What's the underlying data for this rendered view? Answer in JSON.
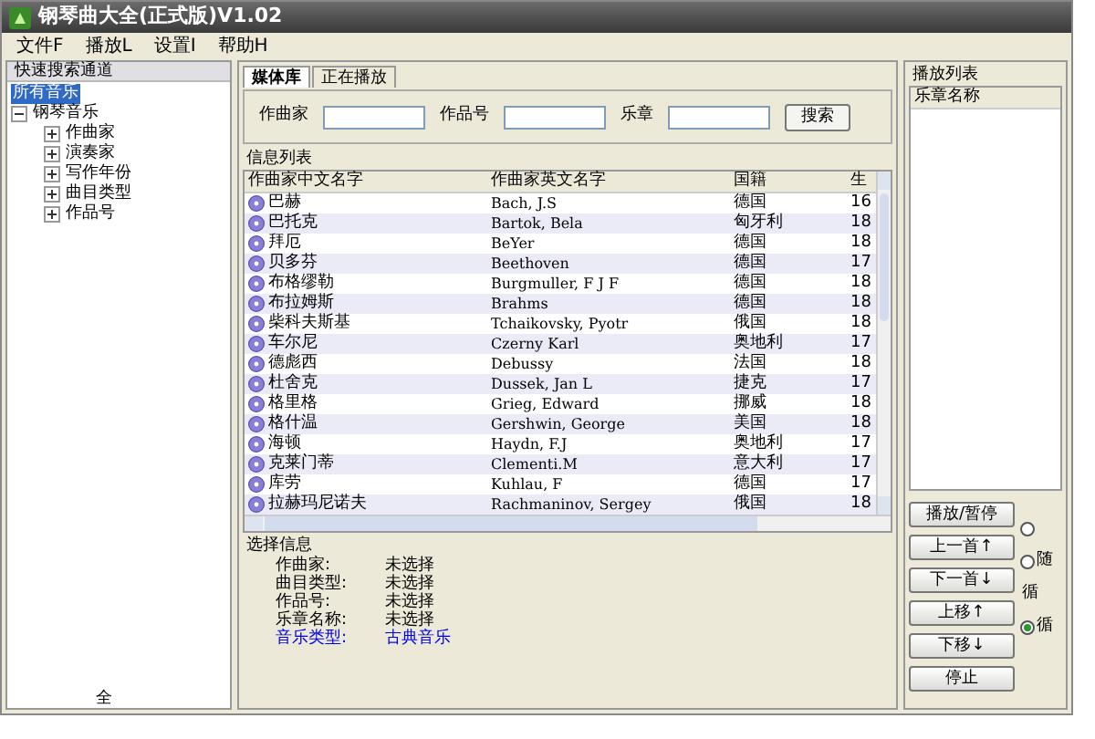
{
  "window": {
    "title": "钢琴曲大全(正式版)V1.02"
  },
  "menu": [
    "文件F",
    "播放L",
    "设置I",
    "帮助H"
  ],
  "sidebar": {
    "title": "快速搜索通道",
    "items": [
      {
        "label": "所有音乐",
        "selected": true
      },
      {
        "label": "钢琴音乐",
        "selected": false,
        "expanded": true,
        "children": [
          {
            "label": "作曲家",
            "selected": false,
            "expanded": false
          },
          {
            "label": "演奏家",
            "selected": false,
            "expanded": false
          },
          {
            "label": "写作年份",
            "selected": false,
            "expanded": false
          },
          {
            "label": "曲目类型",
            "selected": false,
            "expanded": false
          },
          {
            "label": "作品号",
            "selected": false,
            "expanded": false
          }
        ]
      }
    ],
    "footer": "全"
  },
  "tabs": [
    {
      "label": "媒体库",
      "selected": true
    },
    {
      "label": "正在播放",
      "selected": false
    }
  ],
  "search": {
    "fields": [
      {
        "label": "作曲家"
      },
      {
        "label": "作品号"
      },
      {
        "label": "乐章"
      }
    ],
    "button": "搜索"
  },
  "table": {
    "title": "信息列表",
    "columns": [
      "作曲家中文名字",
      "作曲家英文名字",
      "国籍",
      "生"
    ],
    "rows": [
      [
        "巴赫",
        "Bach, J.S",
        "德国",
        "16"
      ],
      [
        "巴托克",
        "Bartok, Bela",
        "匈牙利",
        "18"
      ],
      [
        "拜厄",
        "BeYer",
        "德国",
        "18"
      ],
      [
        "贝多芬",
        "Beethoven",
        "德国",
        "17"
      ],
      [
        "布格缪勒",
        "Burgmuller, F J F",
        "德国",
        "18"
      ],
      [
        "布拉姆斯",
        "Brahms",
        "德国",
        "18"
      ],
      [
        "柴科夫斯基",
        "Tchaikovsky, Pyotr",
        "俄国",
        "18"
      ],
      [
        "车尔尼",
        "Czerny Karl",
        "奥地利",
        "17"
      ],
      [
        "德彪西",
        "Debussy",
        "法国",
        "18"
      ],
      [
        "杜舍克",
        "Dussek, Jan L",
        "捷克",
        "17"
      ],
      [
        "格里格",
        "Grieg, Edward",
        "挪威",
        "18"
      ],
      [
        "格什温",
        "Gershwin, George",
        "美国",
        "18"
      ],
      [
        "海顿",
        "Haydn, F.J",
        "奥地利",
        "17"
      ],
      [
        "克莱门蒂",
        "Clementi.M",
        "意大利",
        "17"
      ],
      [
        "库劳",
        "Kuhlau, F",
        "德国",
        "17"
      ],
      [
        "拉赫玛尼诺夫",
        "Rachmaninov, Sergey",
        "俄国",
        "18"
      ]
    ]
  },
  "selection_info": {
    "title": "选择信息",
    "items": [
      {
        "label": "作曲家:",
        "value": "未选择",
        "highlighted": false
      },
      {
        "label": "曲目类型:",
        "value": "未选择",
        "highlighted": false
      },
      {
        "label": "作品号:",
        "value": "未选择",
        "highlighted": false
      },
      {
        "label": "乐章名称:",
        "value": "未选择",
        "highlighted": false
      },
      {
        "label": "音乐类型:",
        "value": "古典音乐",
        "highlighted": true
      }
    ]
  },
  "playlist": {
    "title": "播放列表",
    "column": "乐章名称"
  },
  "controls": {
    "buttons": [
      "播放/暂停",
      "上一首↑",
      "下一首↓",
      "上移↑",
      "下移↓",
      "停止"
    ],
    "options": [
      {
        "kind": "radio",
        "selected": false
      },
      {
        "kind": "radio",
        "label": "随",
        "selected": false
      },
      {
        "kind": "label",
        "label": "循"
      },
      {
        "kind": "radio",
        "label": "循",
        "selected": true
      }
    ]
  }
}
